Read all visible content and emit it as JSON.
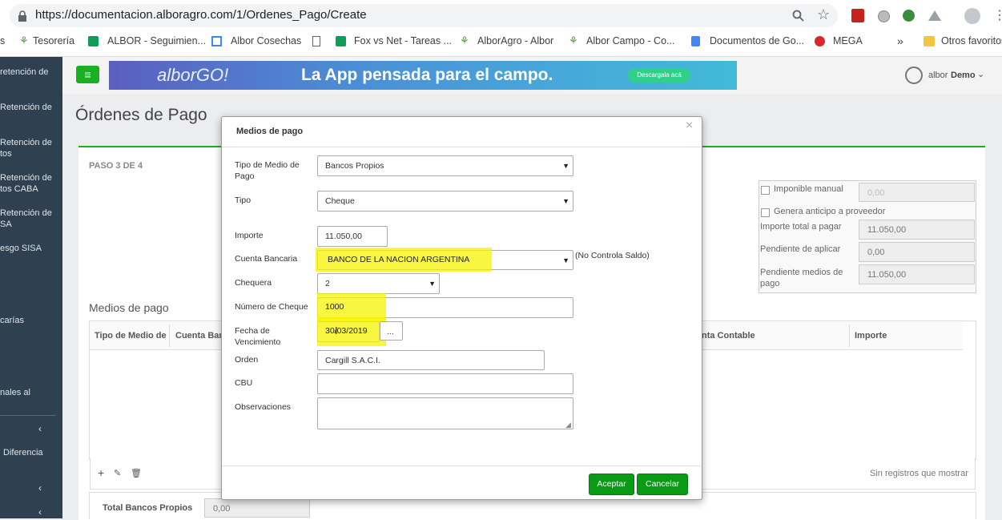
{
  "browser": {
    "url": "https://documentacion.alboragro.com/1/Ordenes_Pago/Create",
    "bookmarks": [
      {
        "label": "s"
      },
      {
        "label": "Tesorería"
      },
      {
        "label": "ALBOR - Seguimien..."
      },
      {
        "label": "Albor Cosechas"
      },
      {
        "label": "Fox vs Net - Tareas ..."
      },
      {
        "label": "AlborAgro - Albor"
      },
      {
        "label": "Albor Campo - Co..."
      },
      {
        "label": "Documentos de Go..."
      },
      {
        "label": "MEGA"
      },
      {
        "label": "»"
      },
      {
        "label": "Otros favoritos"
      }
    ]
  },
  "sidebar": {
    "items": [
      {
        "label": "retención de"
      },
      {
        "label": "Retención de"
      },
      {
        "label": "Retención de\ntos"
      },
      {
        "label": "Retención de\ntos CABA"
      },
      {
        "label": "Retención de\nSA"
      },
      {
        "label": "esgo SISA"
      },
      {
        "label": "carías"
      },
      {
        "label": "nales al"
      },
      {
        "label": "Diferencia"
      }
    ],
    "chevron": "‹"
  },
  "header": {
    "banner_logo": "alborGO!",
    "banner_text": "La App pensada para el campo.",
    "banner_button": "Descargala acá",
    "user_name": "albor",
    "user_company": "Demo"
  },
  "page": {
    "title": "Órdenes de Pago",
    "step": "PASO 3 DE 4",
    "imponible_manual_label": "Imponible manual",
    "imponible_manual_value": "0,00",
    "genera_anticipo_label": "Genera anticipo a proveedor",
    "importe_total_label": "Importe total a pagar",
    "importe_total_value": "11.050,00",
    "pendiente_aplicar_label": "Pendiente de aplicar",
    "pendiente_aplicar_value": "0,00",
    "pendiente_medios_label": "Pendiente medios de pago",
    "pendiente_medios_value": "11.050,00",
    "medios_title": "Medios de pago",
    "table_headers": [
      "Tipo de Medio de",
      "Cuenta Ban",
      "nta Contable",
      "Importe"
    ],
    "empty_text": "Sin registros que mostrar",
    "total_label": "Total Bancos Propios",
    "total_value": "0,00"
  },
  "modal": {
    "title": "Medios de pago",
    "close": "×",
    "fields": {
      "tipo_medio_label": "Tipo de Medio de Pago",
      "tipo_medio_value": "Bancos Propios",
      "tipo_label": "Tipo",
      "tipo_value": "Cheque",
      "importe_label": "Importe",
      "importe_value": "11.050,00",
      "cuenta_label": "Cuenta Bancaria",
      "cuenta_value": "BANCO DE LA NACION ARGENTINA",
      "cuenta_note": "(No Controla Saldo)",
      "chequera_label": "Chequera",
      "chequera_value": "2",
      "numero_label": "Número de Cheque",
      "numero_value": "1000",
      "fecha_label": "Fecha de Vencimiento",
      "fecha_value": "30/03/2019",
      "fecha_button": "...",
      "orden_label": "Orden",
      "orden_value": "Cargill S.A.C.I.",
      "cbu_label": "CBU",
      "cbu_value": "",
      "obs_label": "Observaciones",
      "obs_value": ""
    },
    "accept_label": "Aceptar",
    "cancel_label": "Cancelar"
  }
}
